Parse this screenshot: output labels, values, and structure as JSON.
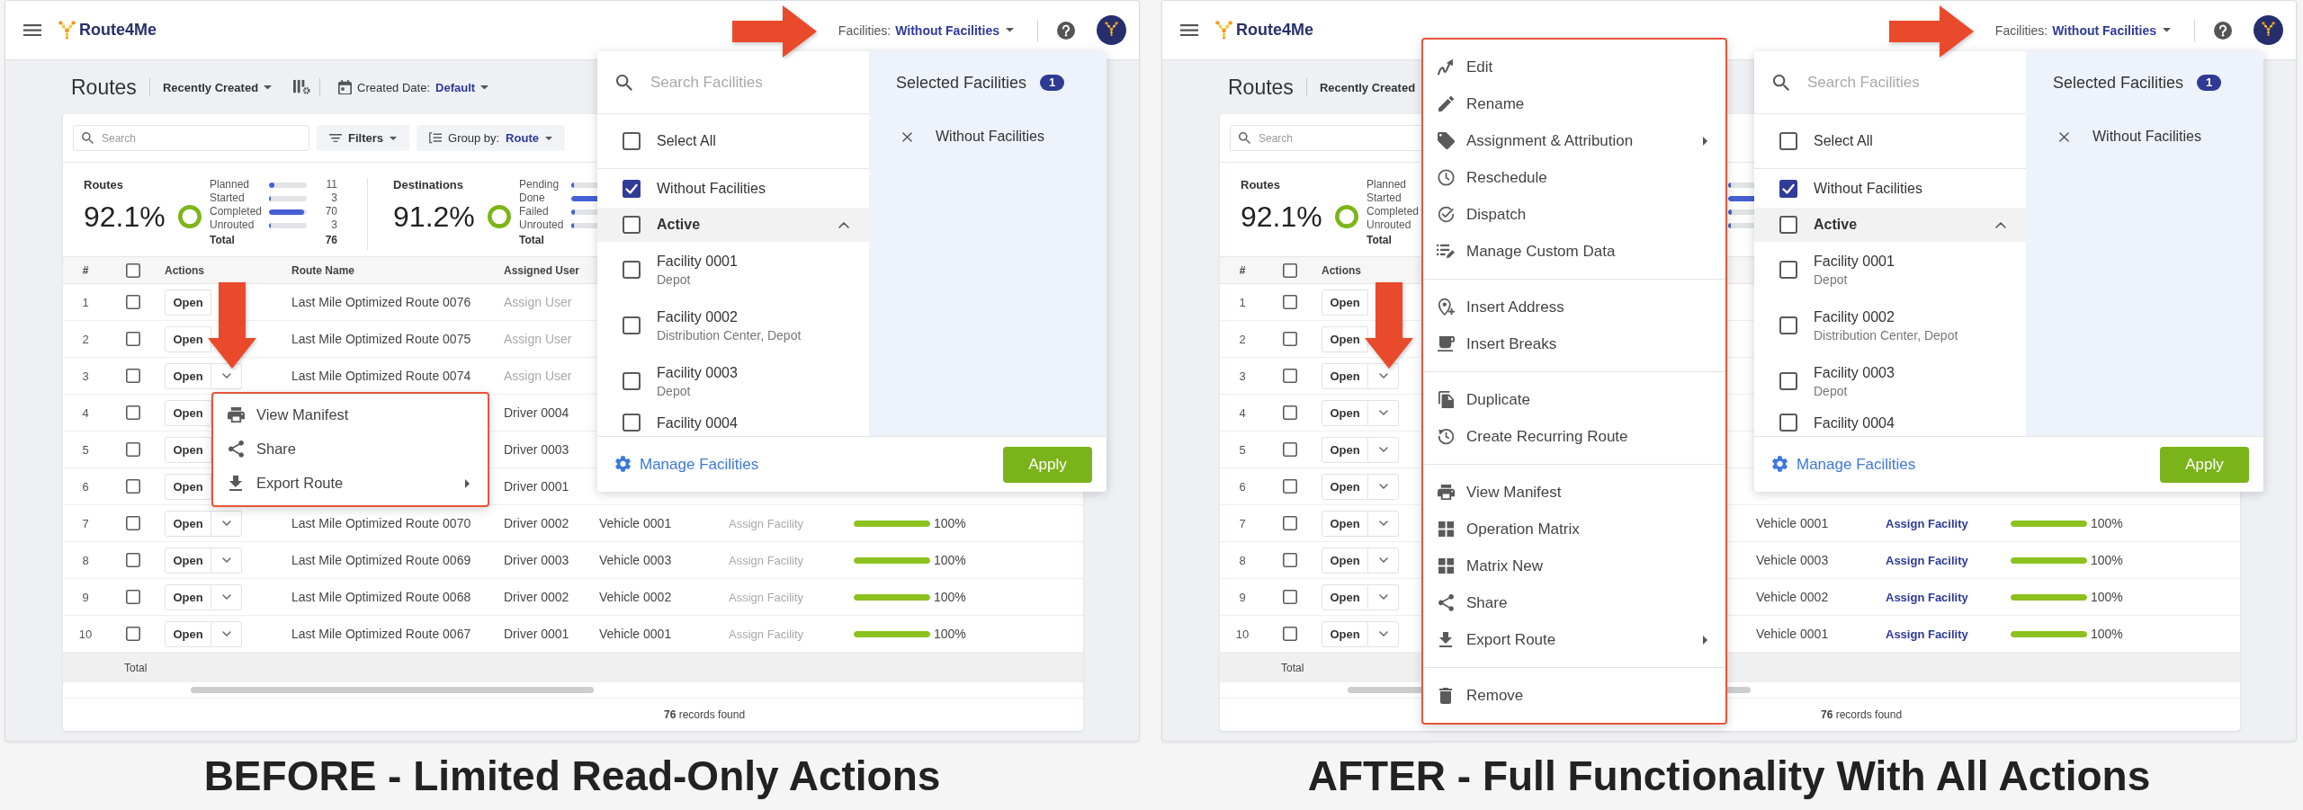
{
  "panels": [
    {
      "caption": "BEFORE - Limited Read-Only Actions",
      "header": {
        "logo": "Route4Me",
        "facilities_label": "Facilities:",
        "facilities_value": "Without Facilities"
      },
      "title_bar": {
        "title": "Routes",
        "controls": [
          {
            "kind": "sort",
            "label": "Recently Created",
            "caret": true
          },
          {
            "kind": "view_settings"
          },
          {
            "kind": "date",
            "label": "Created Date:",
            "value": "Default"
          }
        ]
      },
      "toolbar": [
        {
          "kind": "search",
          "placeholder": "Search"
        },
        {
          "kind": "filters",
          "label": "Filters"
        },
        {
          "kind": "group_by",
          "label": "Group by:",
          "value": "Route"
        }
      ],
      "stats": [
        {
          "label": "Routes",
          "percent": "92.1%",
          "rows": [
            {
              "name": "Planned",
              "level": 0.14,
              "value": "11"
            },
            {
              "name": "Started",
              "level": 0.04,
              "value": "3"
            },
            {
              "name": "Completed",
              "level": 0.92,
              "value": "70"
            },
            {
              "name": "Unrouted",
              "level": 0.04,
              "value": "3"
            }
          ],
          "total": {
            "name": "Total",
            "value": "76"
          }
        },
        {
          "label": "Destinations",
          "percent": "91.2%",
          "rows": [
            {
              "name": "Pending",
              "level": 0.08
            },
            {
              "name": "Done",
              "level": 0.9
            },
            {
              "name": "Failed",
              "level": 0.1
            },
            {
              "name": "Unrouted",
              "level": 0.06
            }
          ],
          "total": {
            "name": "Total"
          }
        }
      ],
      "table": {
        "columns": [
          {
            "kind": "text",
            "label": "#"
          },
          {
            "kind": "checkbox",
            "checked": false
          },
          {
            "kind": "text",
            "label": "Actions"
          },
          {
            "kind": "text",
            "label": "Route Name"
          },
          {
            "kind": "text",
            "label": "Assigned User"
          }
        ],
        "rows": [
          {
            "number": "1",
            "checked": false,
            "open": "Open",
            "dropdown": false,
            "route_name": "Last Mile Optimized Route 0076",
            "assigned_user": {
              "kind": "link",
              "text": "Assign User",
              "disabled": true
            }
          },
          {
            "number": "2",
            "checked": false,
            "open": "Open",
            "dropdown": false,
            "route_name": "Last Mile Optimized Route 0075",
            "assigned_user": {
              "kind": "link",
              "text": "Assign User",
              "disabled": true
            }
          },
          {
            "number": "3",
            "checked": false,
            "open": "Open",
            "dropdown": true,
            "route_name": "Last Mile Optimized Route 0074",
            "assigned_user": {
              "kind": "link",
              "text": "Assign User",
              "disabled": true
            }
          },
          {
            "number": "4",
            "checked": false,
            "open": "Open",
            "dropdown": false,
            "assigned_user": {
              "kind": "text",
              "text": "Driver 0004",
              "disabled": false
            }
          },
          {
            "number": "5",
            "checked": false,
            "open": "Open",
            "dropdown": false,
            "assigned_user": {
              "kind": "text",
              "text": "Driver 0003",
              "disabled": false
            }
          },
          {
            "number": "6",
            "checked": false,
            "open": "Open",
            "dropdown": false,
            "assigned_user": {
              "kind": "text",
              "text": "Driver 0001",
              "disabled": false
            }
          },
          {
            "number": "7",
            "checked": false,
            "open": "Open",
            "dropdown": true,
            "route_name": "Last Mile Optimized Route 0070",
            "assigned_user": {
              "kind": "text",
              "text": "Driver 0002",
              "disabled": false
            },
            "vehicle": "Vehicle 0001",
            "facility": {
              "text": "Assign Facility",
              "disabled": true
            },
            "progress": {
              "level": 1,
              "reading": "100%"
            }
          },
          {
            "number": "8",
            "checked": false,
            "open": "Open",
            "dropdown": true,
            "route_name": "Last Mile Optimized Route 0069",
            "assigned_user": {
              "kind": "text",
              "text": "Driver 0003",
              "disabled": false
            },
            "vehicle": "Vehicle 0003",
            "facility": {
              "text": "Assign Facility",
              "disabled": true
            },
            "progress": {
              "level": 1,
              "reading": "100%"
            }
          },
          {
            "number": "9",
            "checked": false,
            "open": "Open",
            "dropdown": true,
            "route_name": "Last Mile Optimized Route 0068",
            "assigned_user": {
              "kind": "text",
              "text": "Driver 0002",
              "disabled": false
            },
            "vehicle": "Vehicle 0002",
            "facility": {
              "text": "Assign Facility",
              "disabled": true
            },
            "progress": {
              "level": 1,
              "reading": "100%"
            }
          },
          {
            "number": "10",
            "checked": false,
            "open": "Open",
            "dropdown": true,
            "route_name": "Last Mile Optimized Route 0067",
            "assigned_user": {
              "kind": "text",
              "text": "Driver 0001",
              "disabled": false
            },
            "vehicle": "Vehicle 0001",
            "facility": {
              "text": "Assign Facility",
              "disabled": true
            },
            "progress": {
              "level": 1,
              "reading": "100%"
            }
          }
        ],
        "total_label": "Total",
        "footer": "**76** records found"
      },
      "facilities_dropdown": {
        "search_placeholder": "Search Facilities",
        "select_all": {
          "label": "Select All",
          "checked": false
        },
        "options": [
          {
            "label": "Without Facilities",
            "checked": true
          }
        ],
        "groups": [
          {
            "label": "Active",
            "checked": false,
            "expanded": true,
            "children": [
              {
                "name": "Facility 0001",
                "detail": "Depot",
                "checked": false
              },
              {
                "name": "Facility 0002",
                "detail": "Distribution Center, Depot",
                "checked": false
              },
              {
                "name": "Facility 0003",
                "detail": "Depot",
                "checked": false
              },
              {
                "name": "Facility 0004",
                "checked": false
              }
            ]
          }
        ],
        "selected_title": "Selected Facilities",
        "selected_count": "1",
        "selected": [
          "Without Facilities"
        ],
        "manage_label": "Manage Facilities",
        "apply_label": "Apply"
      },
      "action_menu": {
        "sections": [
          {
            "items": [
              {
                "kind": "manifest",
                "label": "View Manifest",
                "submenu": false
              },
              {
                "kind": "share",
                "label": "Share",
                "submenu": false
              },
              {
                "kind": "export",
                "label": "Export Route",
                "submenu": true
              }
            ]
          }
        ]
      }
    },
    {
      "caption": "AFTER - Full Functionality With All Actions",
      "header": {
        "logo": "Route4Me",
        "facilities_label": "Facilities:",
        "facilities_value": "Without Facilities"
      },
      "title_bar": {
        "title": "Routes",
        "controls": [
          {
            "kind": "sort",
            "label": "Recently Created",
            "caret": false
          }
        ]
      },
      "toolbar": [
        {
          "kind": "search",
          "placeholder": "Search"
        }
      ],
      "stats": [
        {
          "label": "Routes",
          "percent": "92.1%",
          "rows": [
            {
              "name": "Planned"
            },
            {
              "name": "Started"
            },
            {
              "name": "Completed"
            },
            {
              "name": "Unrouted"
            }
          ],
          "total": {
            "name": "Total"
          }
        },
        {
          "rows": [
            {
              "level": 0.08
            },
            {
              "level": 0.9
            },
            {
              "level": 0.1
            },
            {
              "level": 0.06
            }
          ]
        }
      ],
      "table": {
        "columns": [
          {
            "kind": "text",
            "label": "#"
          },
          {
            "kind": "checkbox",
            "checked": false
          },
          {
            "kind": "text",
            "label": "Actions"
          }
        ],
        "rows": [
          {
            "number": "1",
            "checked": false,
            "open": "Open",
            "dropdown": false
          },
          {
            "number": "2",
            "checked": false,
            "open": "Open",
            "dropdown": false
          },
          {
            "number": "3",
            "checked": false,
            "open": "Open",
            "dropdown": true
          },
          {
            "number": "4",
            "checked": false,
            "open": "Open",
            "dropdown": true
          },
          {
            "number": "5",
            "checked": false,
            "open": "Open",
            "dropdown": true
          },
          {
            "number": "6",
            "checked": false,
            "open": "Open",
            "dropdown": true
          },
          {
            "number": "7",
            "checked": false,
            "open": "Open",
            "dropdown": true,
            "vehicle": "Vehicle 0001",
            "facility": {
              "text": "Assign Facility",
              "disabled": false
            },
            "progress": {
              "level": 1,
              "reading": "100%"
            }
          },
          {
            "number": "8",
            "checked": false,
            "open": "Open",
            "dropdown": true,
            "vehicle": "Vehicle 0003",
            "facility": {
              "text": "Assign Facility",
              "disabled": false
            },
            "progress": {
              "level": 1,
              "reading": "100%"
            }
          },
          {
            "number": "9",
            "checked": false,
            "open": "Open",
            "dropdown": true,
            "vehicle": "Vehicle 0002",
            "facility": {
              "text": "Assign Facility",
              "disabled": false
            },
            "progress": {
              "level": 1,
              "reading": "100%"
            }
          },
          {
            "number": "10",
            "checked": false,
            "open": "Open",
            "dropdown": true,
            "vehicle": "Vehicle 0001",
            "facility": {
              "text": "Assign Facility",
              "disabled": false
            },
            "progress": {
              "level": 1,
              "reading": "100%"
            }
          }
        ],
        "total_label": "Total",
        "footer": "**76** records found"
      },
      "facilities_dropdown": {
        "search_placeholder": "Search Facilities",
        "select_all": {
          "label": "Select All",
          "checked": false
        },
        "options": [
          {
            "label": "Without Facilities",
            "checked": true
          }
        ],
        "groups": [
          {
            "label": "Active",
            "checked": false,
            "expanded": true,
            "children": [
              {
                "name": "Facility 0001",
                "detail": "Depot",
                "checked": false
              },
              {
                "name": "Facility 0002",
                "detail": "Distribution Center, Depot",
                "checked": false
              },
              {
                "name": "Facility 0003",
                "detail": "Depot",
                "checked": false
              },
              {
                "name": "Facility 0004",
                "checked": false
              }
            ]
          }
        ],
        "selected_title": "Selected Facilities",
        "selected_count": "1",
        "selected": [
          "Without Facilities"
        ],
        "manage_label": "Manage Facilities",
        "apply_label": "Apply"
      },
      "action_menu": {
        "sections": [
          {
            "items": [
              {
                "kind": "edit",
                "label": "Edit",
                "submenu": false
              },
              {
                "kind": "rename",
                "label": "Rename",
                "submenu": false
              },
              {
                "kind": "assign",
                "label": "Assignment & Attribution",
                "submenu": true
              },
              {
                "kind": "reschedule",
                "label": "Reschedule",
                "submenu": false
              },
              {
                "kind": "dispatch",
                "label": "Dispatch",
                "submenu": false
              },
              {
                "kind": "custom_data",
                "label": "Manage Custom Data",
                "submenu": false
              }
            ]
          },
          {
            "items": [
              {
                "kind": "insert_address",
                "label": "Insert Address",
                "submenu": false
              },
              {
                "kind": "insert_breaks",
                "label": "Insert Breaks",
                "submenu": false
              }
            ]
          },
          {
            "items": [
              {
                "kind": "duplicate",
                "label": "Duplicate",
                "submenu": false
              },
              {
                "kind": "recurring",
                "label": "Create Recurring Route",
                "submenu": false
              }
            ]
          },
          {
            "items": [
              {
                "kind": "manifest",
                "label": "View Manifest",
                "submenu": false
              },
              {
                "kind": "matrix",
                "label": "Operation Matrix",
                "submenu": false
              },
              {
                "kind": "matrix",
                "label": "Matrix New",
                "submenu": false
              },
              {
                "kind": "share",
                "label": "Share",
                "submenu": false
              },
              {
                "kind": "export",
                "label": "Export Route",
                "submenu": true
              }
            ]
          },
          {
            "items": [
              {
                "kind": "remove",
                "label": "Remove",
                "submenu": false
              }
            ]
          }
        ]
      }
    }
  ]
}
